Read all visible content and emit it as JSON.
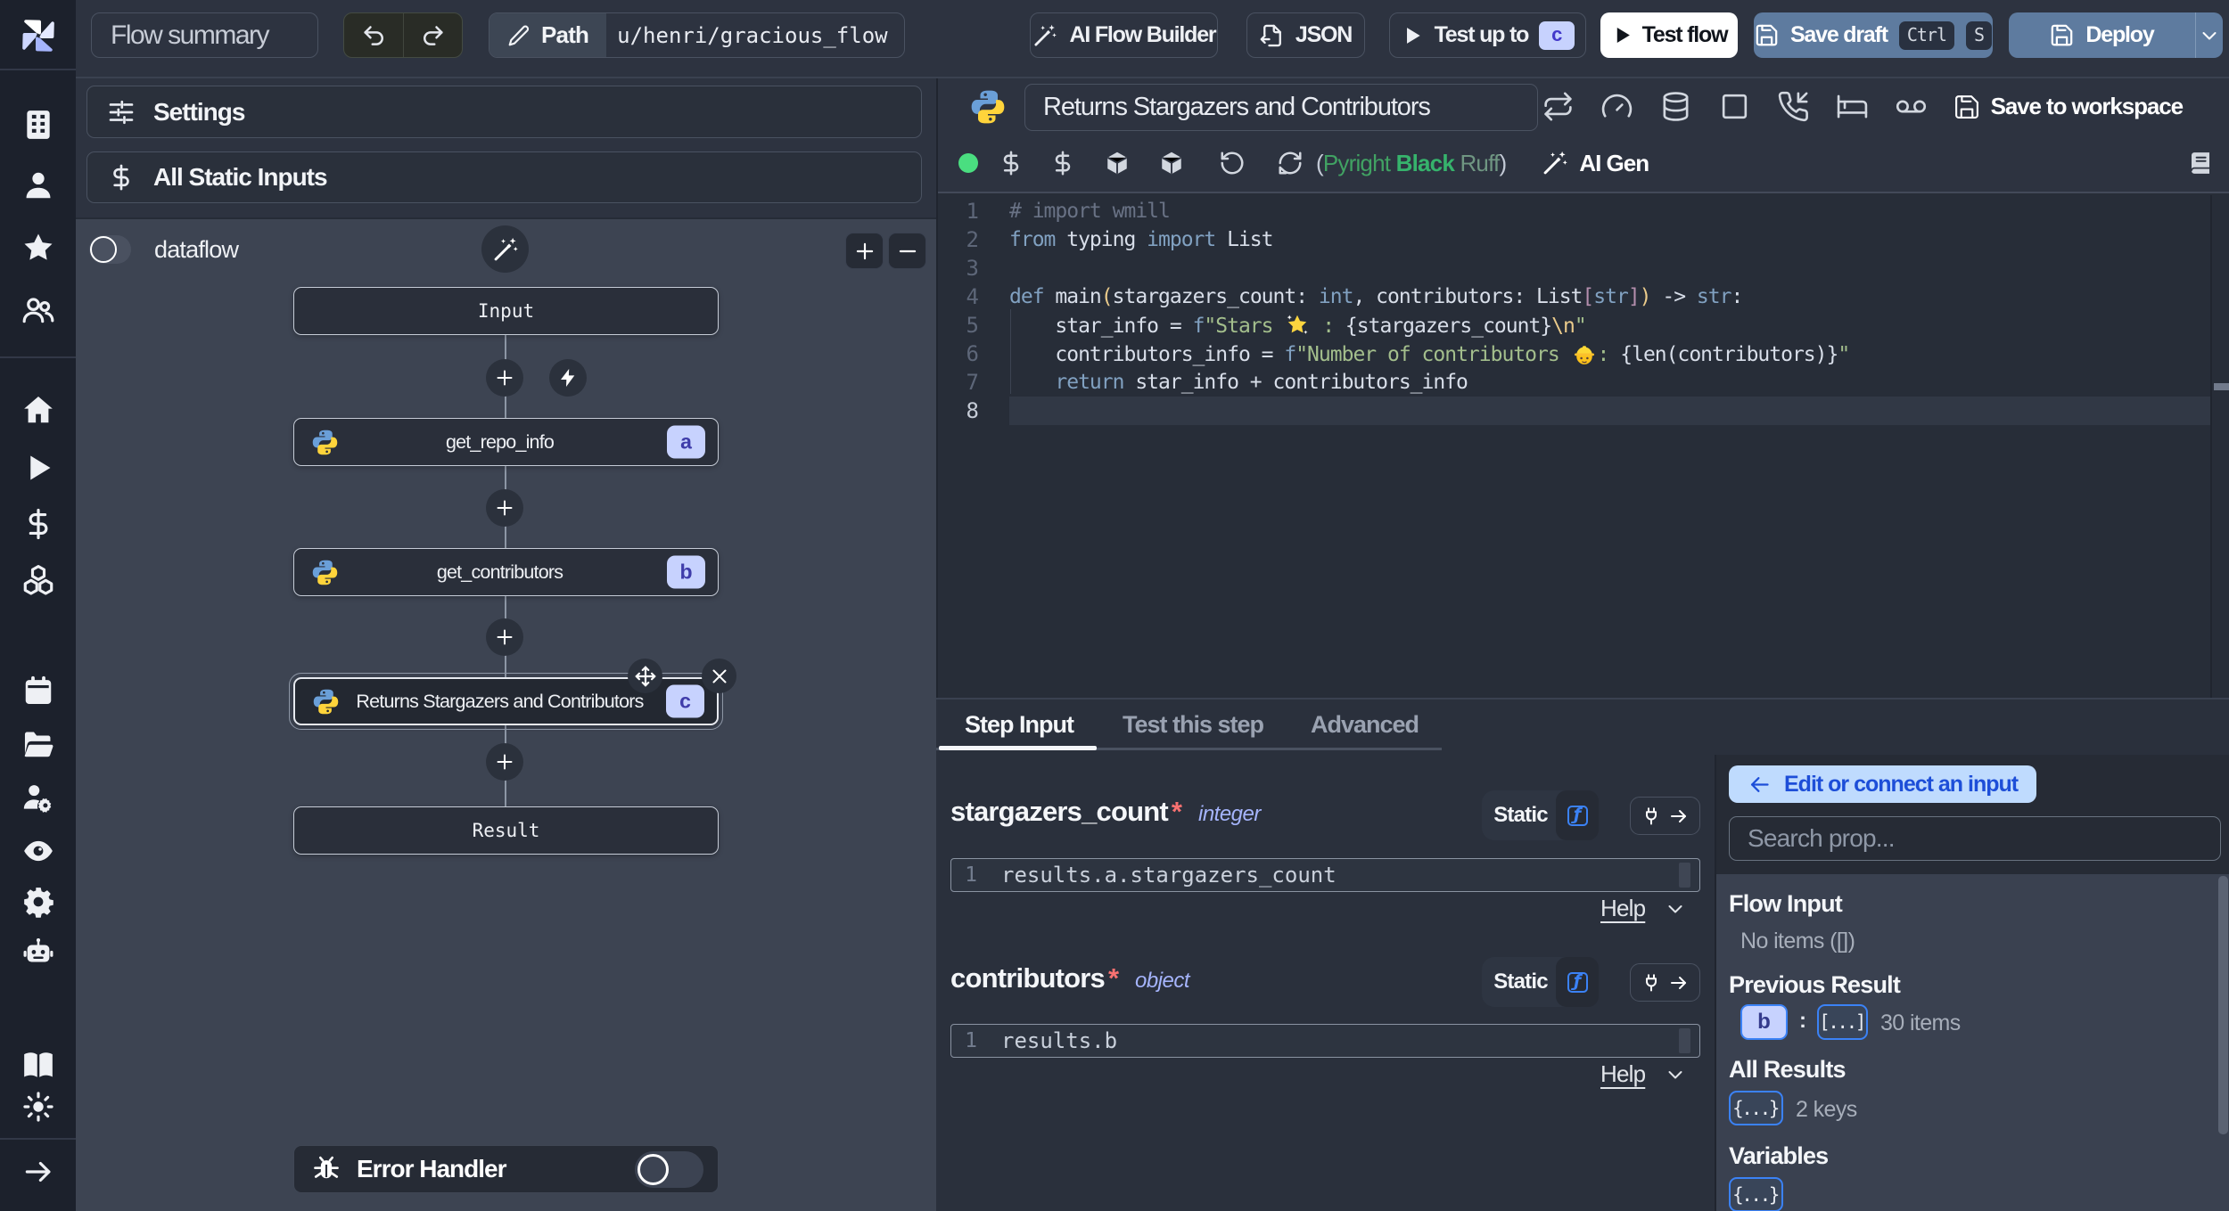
{
  "topbar": {
    "flow_summary": "Flow summary",
    "path_label": "Path",
    "path_value": "u/henri/gracious_flow",
    "ai_flow_builder": "AI Flow Builder",
    "json": "JSON",
    "test_up_to": "Test up to",
    "test_up_to_badge": "c",
    "test_flow": "Test flow",
    "save_draft": "Save draft",
    "save_draft_kbd": [
      "Ctrl",
      "S"
    ],
    "deploy": "Deploy"
  },
  "sidebar": {
    "items": [
      {
        "name": "windmill-logo",
        "icon": "windmill"
      },
      {
        "name": "sidebar-item-apps",
        "icon": "building"
      },
      {
        "name": "sidebar-item-user",
        "icon": "user"
      },
      {
        "name": "sidebar-item-favorites",
        "icon": "star"
      },
      {
        "name": "sidebar-item-groups",
        "icon": "users"
      },
      {
        "name": "sidebar-item-home",
        "icon": "home"
      },
      {
        "name": "sidebar-item-runs",
        "icon": "play"
      },
      {
        "name": "sidebar-item-variables",
        "icon": "dollar"
      },
      {
        "name": "sidebar-item-resources",
        "icon": "cubes"
      },
      {
        "name": "sidebar-item-schedules",
        "icon": "calendar"
      },
      {
        "name": "sidebar-item-folders",
        "icon": "folder"
      },
      {
        "name": "sidebar-item-workers",
        "icon": "users-gear"
      },
      {
        "name": "sidebar-item-audit-logs",
        "icon": "eye"
      },
      {
        "name": "sidebar-item-settings",
        "icon": "gear"
      },
      {
        "name": "sidebar-item-ai",
        "icon": "robot"
      },
      {
        "name": "sidebar-item-docs",
        "icon": "book"
      },
      {
        "name": "sidebar-item-theme",
        "icon": "sun"
      },
      {
        "name": "sidebar-item-expand",
        "icon": "arrow-right"
      }
    ]
  },
  "left_panel": {
    "settings": "Settings",
    "all_static_inputs": "All Static Inputs",
    "dataflow_label": "dataflow",
    "graph": {
      "nodes": [
        {
          "label": "Input"
        },
        {
          "label": "get_repo_info",
          "badge": "a"
        },
        {
          "label": "get_contributors",
          "badge": "b"
        },
        {
          "label": "Returns Stargazers and Contributors",
          "badge": "c"
        },
        {
          "label": "Result"
        }
      ]
    },
    "error_handler": "Error Handler"
  },
  "editor": {
    "name_value": "Returns Stargazers and Contributors",
    "save_to_workspace": "Save to workspace",
    "assistants_prefix": "(",
    "assistants": [
      "Pyright",
      "Black",
      "Ruff"
    ],
    "assistants_suffix": ")",
    "ai_gen": "AI Gen",
    "code": {
      "lines": [
        [
          {
            "c": "cmt",
            "t": "# import wmill"
          }
        ],
        [
          {
            "c": "kw",
            "t": "from"
          },
          {
            "c": "txt",
            "t": " typing "
          },
          {
            "c": "kw",
            "t": "import"
          },
          {
            "c": "txt",
            "t": " List"
          }
        ],
        [],
        [
          {
            "c": "kw",
            "t": "def"
          },
          {
            "c": "txt",
            "t": " main"
          },
          {
            "c": "b1",
            "t": "("
          },
          {
            "c": "txt",
            "t": "stargazers_count: "
          },
          {
            "c": "kw",
            "t": "int"
          },
          {
            "c": "txt",
            "t": ", contributors: List"
          },
          {
            "c": "b2",
            "t": "["
          },
          {
            "c": "kw",
            "t": "str"
          },
          {
            "c": "b2",
            "t": "]"
          },
          {
            "c": "b1",
            "t": ")"
          },
          {
            "c": "txt",
            "t": " -> "
          },
          {
            "c": "kw",
            "t": "str"
          },
          {
            "c": "txt",
            "t": ":"
          }
        ],
        [
          {
            "c": "txt",
            "t": "    star_info = "
          },
          {
            "c": "kw",
            "t": "f"
          },
          {
            "c": "str",
            "t": "\"Stars "
          },
          {
            "c": "emoji",
            "t": "star"
          },
          {
            "c": "str",
            "t": " : "
          },
          {
            "c": "txt",
            "t": "{stargazers_count}"
          },
          {
            "c": "esc",
            "t": "\\n"
          },
          {
            "c": "str",
            "t": "\""
          }
        ],
        [
          {
            "c": "txt",
            "t": "    contributors_info = "
          },
          {
            "c": "kw",
            "t": "f"
          },
          {
            "c": "str",
            "t": "\"Number of contributors "
          },
          {
            "c": "emoji",
            "t": "worker"
          },
          {
            "c": "str",
            "t": ": "
          },
          {
            "c": "txt",
            "t": "{len(contributors)}"
          },
          {
            "c": "str",
            "t": "\""
          }
        ],
        [
          {
            "c": "txt",
            "t": "    "
          },
          {
            "c": "kw",
            "t": "return"
          },
          {
            "c": "txt",
            "t": " star_info + contributors_info"
          }
        ],
        []
      ],
      "current_line": 8
    }
  },
  "bottom": {
    "tabs": [
      "Step Input",
      "Test this step",
      "Advanced"
    ],
    "active_tab": "Step Input",
    "fx_symbol": "ƒ",
    "fields": [
      {
        "name": "stargazers_count",
        "required": "*",
        "type": "integer",
        "mode": "Static",
        "line": "1",
        "expr": "results.a.stargazers_count",
        "help": "Help"
      },
      {
        "name": "contributors",
        "required": "*",
        "type": "object",
        "mode": "Static",
        "line": "1",
        "expr": "results.b",
        "help": "Help"
      }
    ]
  },
  "prop_panel": {
    "edit_button": "Edit or connect an input",
    "search_placeholder": "Search prop...",
    "flow_input_title": "Flow Input",
    "flow_input_empty": "No items ([])",
    "previous_result_title": "Previous Result",
    "previous_result_badge": "b",
    "colon": ":",
    "previous_result_value": "[...]",
    "previous_result_meta": "30 items",
    "all_results_title": "All Results",
    "all_results_value": "{...}",
    "all_results_meta": "2 keys",
    "variables_title": "Variables",
    "variables_value": "{...}"
  },
  "colors": {
    "accent_blue": "#5e7b9f",
    "lavender": "#c7d2fe",
    "light_blue": "#bfdbfe",
    "green_dot": "#4ade80"
  }
}
